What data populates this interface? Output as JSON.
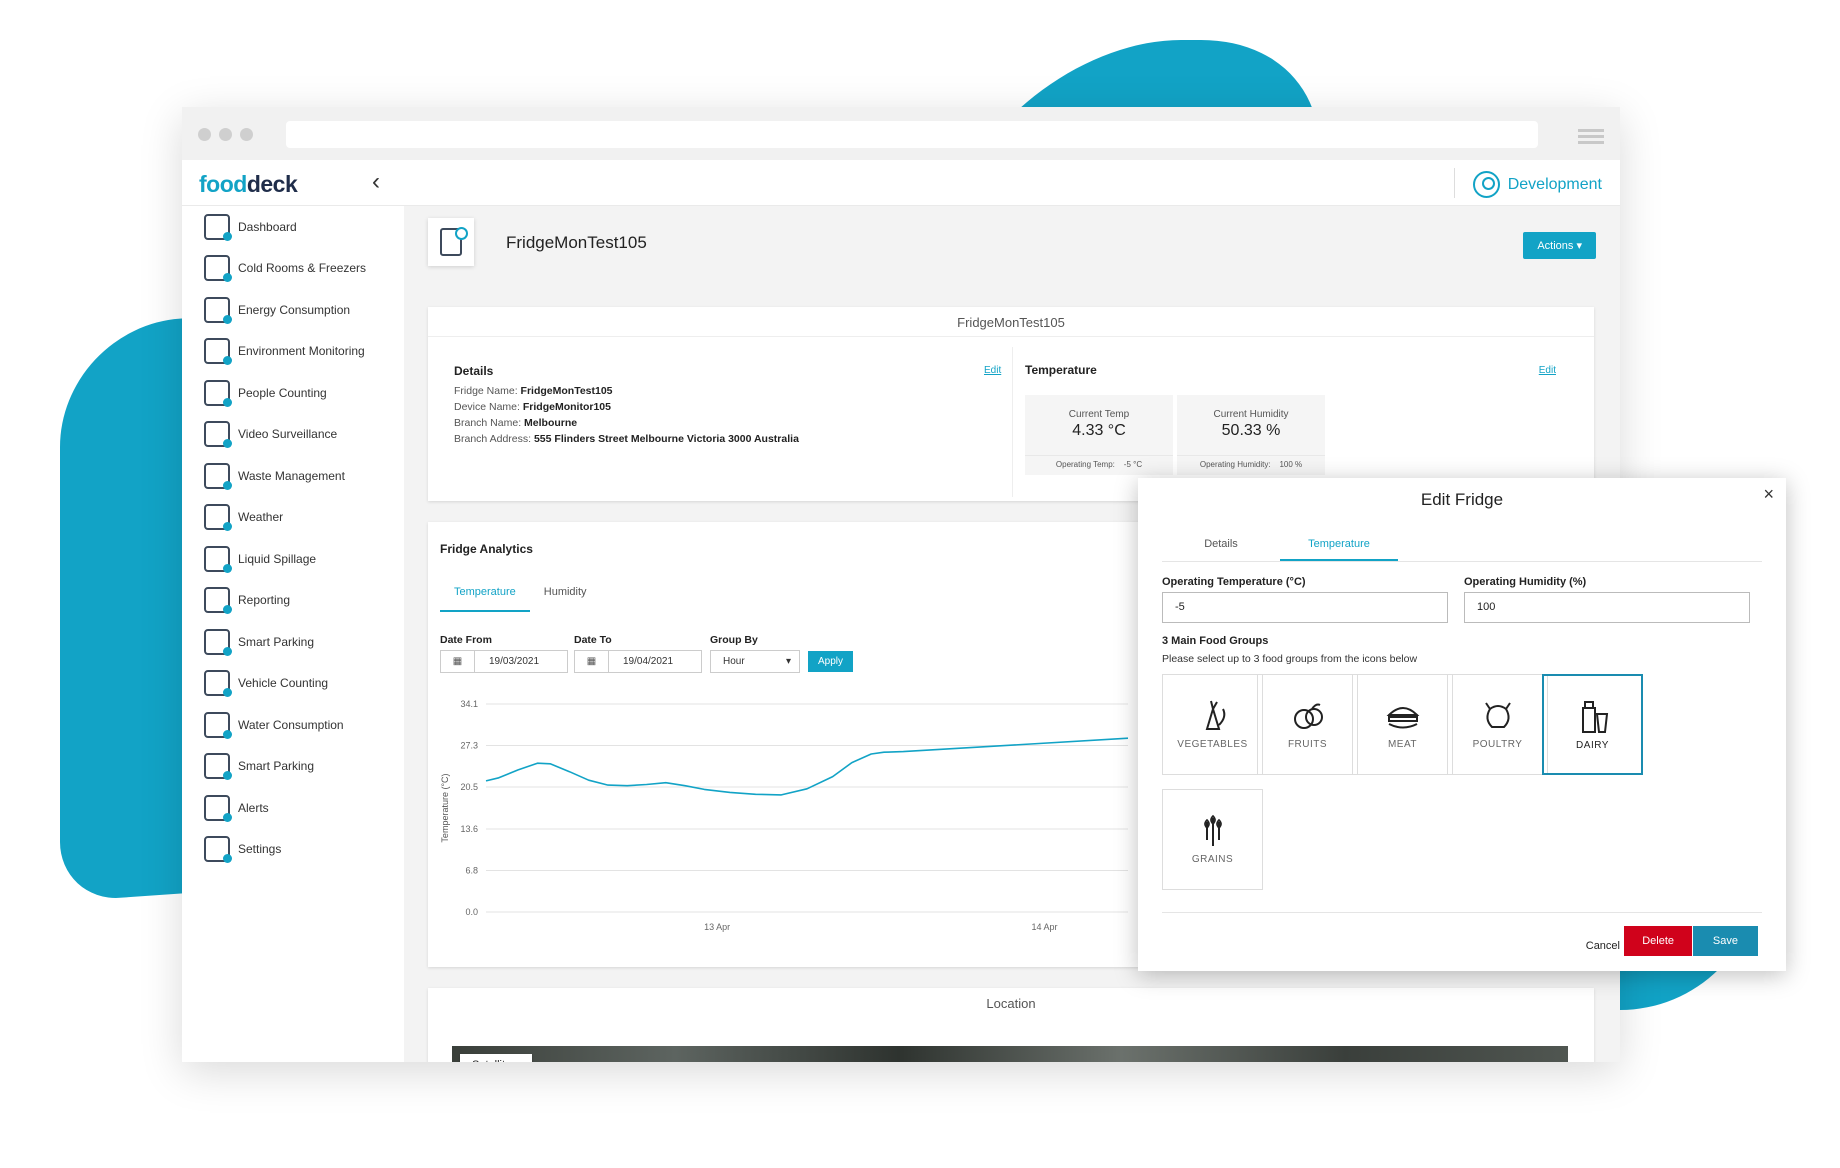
{
  "app": {
    "logo_a": "food",
    "logo_b": "deck",
    "user": "Development"
  },
  "sidebar": {
    "items": [
      {
        "label": "Dashboard",
        "icon": "dashboard-icon"
      },
      {
        "label": "Cold Rooms & Freezers",
        "icon": "fridge-icon"
      },
      {
        "label": "Energy Consumption",
        "icon": "energy-icon"
      },
      {
        "label": "Environment Monitoring",
        "icon": "leaf-icon"
      },
      {
        "label": "People Counting",
        "icon": "people-icon"
      },
      {
        "label": "Video Surveillance",
        "icon": "camera-icon"
      },
      {
        "label": "Waste Management",
        "icon": "bin-icon"
      },
      {
        "label": "Weather",
        "icon": "weather-icon"
      },
      {
        "label": "Liquid Spillage",
        "icon": "spill-icon"
      },
      {
        "label": "Reporting",
        "icon": "report-icon"
      },
      {
        "label": "Smart Parking",
        "icon": "parking-icon"
      },
      {
        "label": "Vehicle Counting",
        "icon": "car-icon"
      },
      {
        "label": "Water Consumption",
        "icon": "water-icon"
      },
      {
        "label": "Smart Parking",
        "icon": "parking-icon"
      },
      {
        "label": "Alerts",
        "icon": "bell-icon"
      },
      {
        "label": "Settings",
        "icon": "settings-icon"
      }
    ]
  },
  "page": {
    "title": "FridgeMonTest105",
    "actions_label": "Actions ▾"
  },
  "summary": {
    "card_title": "FridgeMonTest105",
    "details_heading": "Details",
    "edit": "Edit",
    "fridge_name_label": "Fridge Name:",
    "fridge_name": "FridgeMonTest105",
    "device_name_label": "Device Name:",
    "device_name": "FridgeMonitor105",
    "branch_name_label": "Branch Name:",
    "branch_name": "Melbourne",
    "branch_address_label": "Branch Address:",
    "branch_address": "555 Flinders Street Melbourne Victoria 3000 Australia",
    "temperature_heading": "Temperature",
    "current_temp_label": "Current Temp",
    "current_temp": "4.33 °C",
    "current_humidity_label": "Current Humidity",
    "current_humidity": "50.33 %",
    "op_temp_label": "Operating Temp:",
    "op_temp": "-5 °C",
    "op_humidity_label": "Operating Humidity:",
    "op_humidity": "100 %"
  },
  "analytics": {
    "heading": "Fridge Analytics",
    "tabs": [
      "Temperature",
      "Humidity"
    ],
    "date_from_label": "Date From",
    "date_from": "19/03/2021",
    "date_to_label": "Date To",
    "date_to": "19/04/2021",
    "group_by_label": "Group By",
    "group_by": "Hour",
    "apply": "Apply"
  },
  "chart_data": {
    "type": "line",
    "ylabel": "Temperature (°C)",
    "yticks": [
      34.1,
      27.3,
      20.5,
      13.6,
      6.8,
      0.0
    ],
    "ylim": [
      0,
      34.1
    ],
    "xticks": [
      "13 Apr",
      "14 Apr"
    ],
    "series": [
      {
        "color": "#12a3c6",
        "x": [
          0,
          0.02,
          0.05,
          0.08,
          0.1,
          0.13,
          0.16,
          0.19,
          0.22,
          0.25,
          0.28,
          0.31,
          0.34,
          0.38,
          0.42,
          0.46,
          0.5,
          0.54,
          0.57,
          0.6,
          0.62,
          0.65,
          1.0
        ],
        "y": [
          21.5,
          22.0,
          23.3,
          24.4,
          24.3,
          23.0,
          21.6,
          20.8,
          20.7,
          20.9,
          21.2,
          20.7,
          20.1,
          19.6,
          19.3,
          19.2,
          20.2,
          22.2,
          24.5,
          25.9,
          26.2,
          26.3,
          28.5
        ]
      }
    ]
  },
  "location": {
    "title": "Location",
    "map_type": "Satellite ▾"
  },
  "modal": {
    "title": "Edit Fridge",
    "close": "×",
    "tabs": [
      "Details",
      "Temperature"
    ],
    "op_temp_label": "Operating Temperature (°C)",
    "op_temp_value": "-5",
    "op_humidity_label": "Operating Humidity (%)",
    "op_humidity_value": "100",
    "food_groups_title": "3 Main Food Groups",
    "food_groups_sub": "Please select up to 3 food groups from the icons below",
    "food_groups": [
      {
        "label": "VEGETABLES",
        "icon": "vegetables-icon",
        "selected": false
      },
      {
        "label": "FRUITS",
        "icon": "fruits-icon",
        "selected": false
      },
      {
        "label": "MEAT",
        "icon": "meat-icon",
        "selected": false
      },
      {
        "label": "POULTRY",
        "icon": "poultry-icon",
        "selected": false
      },
      {
        "label": "DAIRY",
        "icon": "dairy-icon",
        "selected": true
      },
      {
        "label": "GRAINS",
        "icon": "grains-icon",
        "selected": false
      }
    ],
    "cancel": "Cancel",
    "delete": "Delete",
    "save": "Save"
  }
}
